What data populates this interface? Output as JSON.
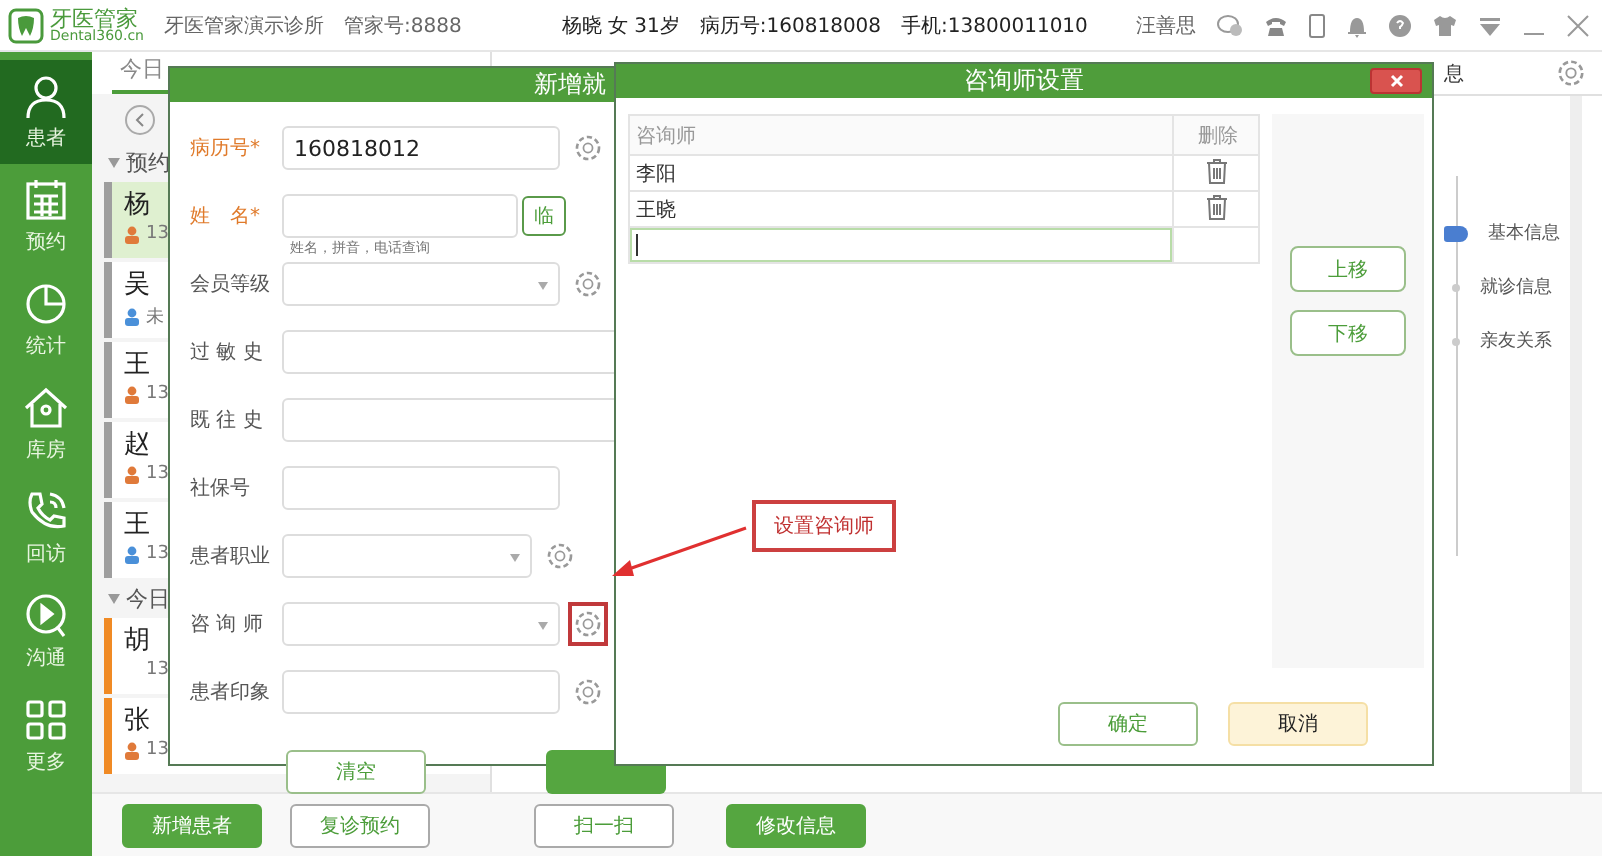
{
  "app": {
    "logo": "牙医管家",
    "logo_url": "Dental360.cn",
    "clinic": "牙医管家演示诊所",
    "account": "管家号:8888",
    "user": "汪善思"
  },
  "patient_header": {
    "summary": "杨晓 女 31岁",
    "record_no": "病历号:160818008",
    "phone": "手机:13800011010"
  },
  "nav": [
    {
      "label": "患者",
      "selected": true
    },
    {
      "label": "预约",
      "selected": false
    },
    {
      "label": "统计",
      "selected": false
    },
    {
      "label": "库房",
      "selected": false
    },
    {
      "label": "回访",
      "selected": false
    },
    {
      "label": "沟通",
      "selected": false
    },
    {
      "label": "更多",
      "selected": false
    }
  ],
  "list_tab": {
    "label": "今日",
    "selected": true
  },
  "patient_groups": [
    {
      "title": "预约",
      "patients": [
        {
          "name": "杨",
          "phone": "13",
          "kind": "female",
          "color": "#9e9e9e",
          "selected": true
        },
        {
          "name": "吴",
          "phone": "未",
          "kind": "male",
          "color": "#9e9e9e",
          "selected": false
        },
        {
          "name": "王",
          "phone": "13",
          "kind": "female",
          "color": "#9e9e9e",
          "selected": false
        },
        {
          "name": "赵",
          "phone": "13",
          "kind": "female",
          "color": "#9e9e9e",
          "selected": false
        },
        {
          "name": "王",
          "phone": "13",
          "kind": "male",
          "color": "#9e9e9e",
          "selected": false
        }
      ]
    },
    {
      "title": "今日",
      "patients": [
        {
          "name": "胡",
          "phone": "13",
          "kind": "plain",
          "color": "#f08a24",
          "selected": false
        },
        {
          "name": "张",
          "phone": "13",
          "kind": "female",
          "color": "#f08a24",
          "selected": false
        }
      ]
    }
  ],
  "right_panel": {
    "tab_fragment": "息",
    "steps": [
      {
        "label": "基本信息",
        "selected": true
      },
      {
        "label": "就诊信息",
        "selected": false
      },
      {
        "label": "亲友关系",
        "selected": false
      }
    ]
  },
  "bottom_buttons": [
    {
      "label": "新增患者",
      "primary": true
    },
    {
      "label": "复诊预约",
      "primary": false
    },
    {
      "label": "扫一扫",
      "primary": false
    },
    {
      "label": "修改信息",
      "primary": true
    }
  ],
  "form_dialog": {
    "title": "新增就",
    "hint": "姓名，拼音，电话查询",
    "temp_button": "临",
    "clear_button": "清空",
    "fields": [
      {
        "label": "病历号*",
        "kind": "text",
        "value": "160818012",
        "required": true,
        "gear": true,
        "highlighted": false
      },
      {
        "label": "姓　名*",
        "kind": "name",
        "required": true,
        "gear": false
      },
      {
        "label": "会员等级",
        "kind": "select",
        "required": false,
        "gear": true,
        "highlighted": false
      },
      {
        "label": "过 敏 史",
        "kind": "text",
        "required": false,
        "gear": false
      },
      {
        "label": "既 往 史",
        "kind": "text",
        "required": false,
        "gear": false
      },
      {
        "label": "社保号",
        "kind": "text",
        "required": false,
        "gear": false
      },
      {
        "label": "患者职业",
        "kind": "select",
        "required": false,
        "gear": true,
        "highlighted": false
      },
      {
        "label": "咨 询 师",
        "kind": "select",
        "required": false,
        "gear": true,
        "highlighted": true
      },
      {
        "label": "患者印象",
        "kind": "text",
        "required": false,
        "gear": true,
        "highlighted": false
      }
    ]
  },
  "counselor_dialog": {
    "title": "咨询师设置",
    "columns": [
      "咨询师",
      "删除"
    ],
    "rows": [
      {
        "name": "李阳"
      },
      {
        "name": "王晓"
      }
    ],
    "move_up": "上移",
    "move_down": "下移",
    "ok": "确定",
    "cancel": "取消"
  },
  "annotation": {
    "text": "设置咨询师"
  }
}
